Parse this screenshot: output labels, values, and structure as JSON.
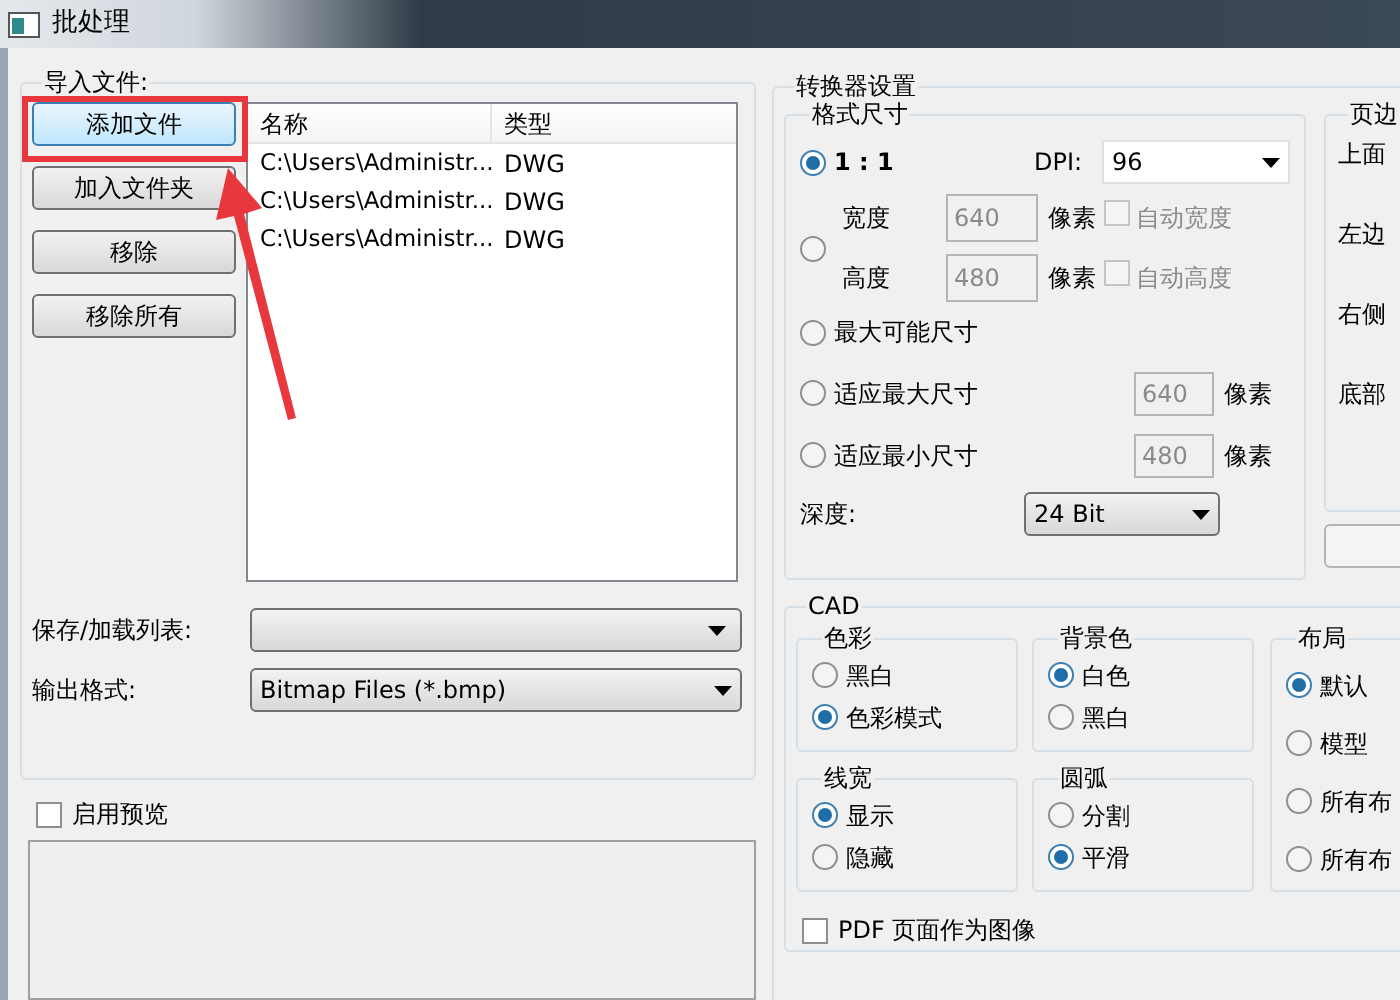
{
  "window": {
    "title": "批处理"
  },
  "import_files": {
    "title": "导入文件:",
    "buttons": [
      {
        "label": "添加文件",
        "focused": true
      },
      {
        "label": "加入文件夹",
        "focused": false
      },
      {
        "label": "移除",
        "focused": false
      },
      {
        "label": "移除所有",
        "focused": false
      }
    ],
    "table": {
      "columns": [
        "名称",
        "类型"
      ],
      "rows": [
        [
          "C:\\Users\\Administr...",
          "DWG"
        ],
        [
          "C:\\Users\\Administr...",
          "DWG"
        ],
        [
          "C:\\Users\\Administr...",
          "DWG"
        ]
      ]
    },
    "save_load_list": {
      "label": "保存/加载列表:"
    },
    "output_format": {
      "label": "输出格式:",
      "value": "Bitmap Files (*.bmp)"
    }
  },
  "enable_preview": {
    "label": "启用预览",
    "checked": false
  },
  "converter_settings": {
    "title": "转换器设置",
    "format_size": {
      "title": "格式尺寸",
      "options": [
        {
          "kind": "dpi",
          "label": "1 : 1",
          "selected": true,
          "dpi_label": "DPI:",
          "dpi_value": "96"
        },
        {
          "kind": "custom",
          "selected": false,
          "fields": [
            {
              "label": "宽度",
              "value": "640",
              "unit": "像素",
              "auto_label": "自动宽度",
              "auto_checked": false,
              "disabled": true
            },
            {
              "label": "高度",
              "value": "480",
              "unit": "像素",
              "auto_label": "自动高度",
              "auto_checked": false,
              "disabled": true
            }
          ]
        },
        {
          "kind": "plain",
          "label": "最大可能尺寸",
          "selected": false
        },
        {
          "kind": "limit",
          "label": "适应最大尺寸",
          "selected": false,
          "value": "640",
          "unit": "像素",
          "disabled": true
        },
        {
          "kind": "limit",
          "label": "适应最小尺寸",
          "selected": false,
          "value": "480",
          "unit": "像素",
          "disabled": true
        }
      ],
      "depth": {
        "label": "深度:",
        "value": "24 Bit"
      }
    },
    "margins": {
      "title": "页边",
      "labels": [
        "上面",
        "左边",
        "右侧",
        "底部"
      ]
    },
    "cad": {
      "title": "CAD",
      "groups": [
        {
          "title": "色彩",
          "options": [
            {
              "label": "黑白",
              "selected": false
            },
            {
              "label": "色彩模式",
              "selected": true
            }
          ]
        },
        {
          "title": "背景色",
          "options": [
            {
              "label": "白色",
              "selected": true
            },
            {
              "label": "黑白",
              "selected": false
            }
          ]
        },
        {
          "title": "线宽",
          "options": [
            {
              "label": "显示",
              "selected": true
            },
            {
              "label": "隐藏",
              "selected": false
            }
          ]
        },
        {
          "title": "圆弧",
          "options": [
            {
              "label": "分割",
              "selected": false
            },
            {
              "label": "平滑",
              "selected": true
            }
          ]
        }
      ],
      "layout": {
        "title": "布局",
        "options": [
          {
            "label": "默认",
            "selected": true
          },
          {
            "label": "模型",
            "selected": false
          },
          {
            "label": "所有布",
            "selected": false
          },
          {
            "label": "所有布",
            "selected": false
          }
        ]
      },
      "pdf_as_image": {
        "label": "PDF 页面作为图像",
        "checked": false
      }
    }
  }
}
